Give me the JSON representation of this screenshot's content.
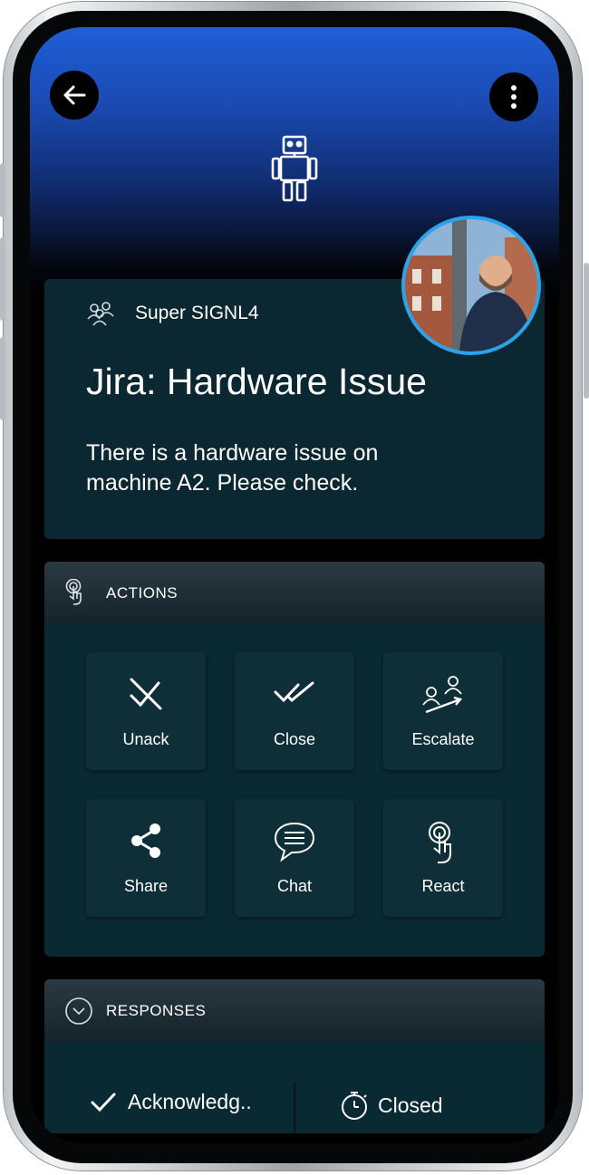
{
  "header": {
    "back_icon": "arrow-left-icon",
    "menu_icon": "vertical-dots-icon",
    "bot_icon": "robot-icon",
    "colors": {
      "top": "#1f5fd8",
      "bottom": "#000000"
    }
  },
  "alert": {
    "team": "Super SIGNL4",
    "title": "Jira: Hardware Issue",
    "description": "There is a hardware issue on machine A2. Please check.",
    "avatar": "user-avatar-photo",
    "avatar_ring_color": "#2aa3ea"
  },
  "actions": {
    "heading": "ACTIONS",
    "items": [
      {
        "label": "Unack",
        "icon": "unack-icon"
      },
      {
        "label": "Close",
        "icon": "double-check-icon"
      },
      {
        "label": "Escalate",
        "icon": "escalate-icon"
      },
      {
        "label": "Share",
        "icon": "share-icon"
      },
      {
        "label": "Chat",
        "icon": "chat-icon"
      },
      {
        "label": "React",
        "icon": "touch-icon"
      }
    ]
  },
  "responses": {
    "heading": "RESPONSES",
    "items": [
      {
        "label": "Acknowledg..",
        "icon": "check-icon"
      },
      {
        "label": "Closed",
        "icon": "stopwatch-icon"
      }
    ]
  },
  "theme": {
    "card_bg": "#0a2a33",
    "text": "#ffffff"
  }
}
